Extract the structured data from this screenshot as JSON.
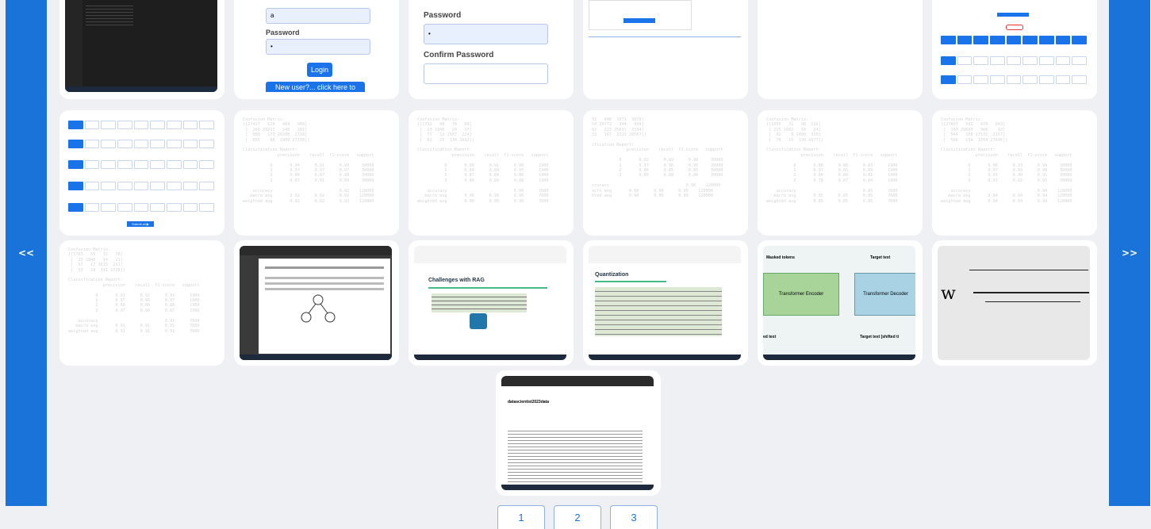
{
  "nav": {
    "prev_label": "<<",
    "next_label": ">>"
  },
  "pagination": [
    "1",
    "2",
    "3"
  ],
  "thumbs": {
    "login": {
      "password_label": "Password",
      "username_value": "a",
      "password_value": "•",
      "login_button": "Login",
      "register_link": "New user?... click here to Register"
    },
    "register": {
      "password_label": "Password",
      "confirm_label": "Confirm Password",
      "password_value": "•"
    },
    "terminal_1": "Confusion Matrix:\n[[27427   620   964   989]\n [  266 29213   240   281]\n [  909   173 26200  2718]\n [  655    98  1909 27338]]\n\nClassification Report:\n              precision    recall  f1-score   support\n\n           0       0.94      0.91      0.93     30000\n           1       0.97      0.97      0.97     30000\n           2       0.89      0.87      0.88     30000\n           3       0.87      0.91      0.89     30000\n\n    accuracy                           0.92    120000\n   macro avg       0.92      0.92      0.92    120000\nweighted avg       0.92      0.92      0.92    120000",
    "terminal_2": "Confusion Matrix:\n[[1712   48   70   60]\n [  23 1840   20   17]\n [  77   12 1587  224]\n [  63   15  130 1692]]\n\nClassification Report:\n              precision    recall  f1-score   support\n\n           0       0.90      0.91      0.90      1900\n           1       0.89      0.84      0.95      1900\n           2       0.87      0.84      0.86      1900\n           3       0.84      0.89      0.88      1900\n\n    accuracy                           0.90      7600\n   macro avg       0.90      0.90      0.90      7600\nweighted avg       0.90      0.90      0.90      7600",
    "terminal_3": "31   640  1671  3878]\n50 20772   344   434]\n02   223 25631  3334]\n33   167  2313 26507]]\n\nification Report:\n              precision    recall  f1-score   support\n\n           0       0.92      0.89      0.90     30000\n           1       0.97      0.96      0.96     30000\n           2       0.86      0.85      0.85     30000\n           3       0.85      0.88      0.86     30000\n\nccuracy                               0.90    120000\nacro avg       0.90      0.90      0.90    120000\nhted avg       0.90      0.90      0.90    120000",
    "terminal_4": "Confusion Matrix:\n[[1655   31   98  116]\n [ 225 1602   39   24]\n [  92    8 1490  310]\n [  78   15  130 1677]]\n\nClassification Report:\n              precision    recall  f1-score   support\n\n           0       0.80      0.88      0.83      1900\n           1       0.97      0.85      0.89      1900\n           2       0.84      0.80      0.81      1900\n           3       0.78      0.87      0.84      1900\n\n    accuracy                           0.85      7600\n   macro avg       0.85      0.85      0.85      7600\nweighted avg       0.85      0.85      0.85      7600",
    "terminal_5": "Confusion Matrix:\n[[27807   592   878   643]\n [  103 29699   306    92]\n [  544   160 27131  2157]\n [  566   134  1654 27646]]\n\nClassification Report:\n              precision    recall  f1-score   support\n\n           0       0.96      0.93      0.94     30000\n           1       0.97      0.99      0.98     30000\n           2       0.91      0.90      0.91     30000\n           3       0.91      0.92      0.91     30000\n\n    accuracy                           0.94    120000\n   macro avg       0.94      0.94      0.94    120000\nweighted avg       0.94      0.94      0.94    120000",
    "terminal_6": "Confusion Matrix:\n[[1703   55   72   70]\n [  25 1840   14   21]\n [  57   17 1615  211]\n [  53   18  111 1718]]\n\nClassification Report:\n              precision    recall  f1-score   support\n\n           0       0.91      0.92      0.91      1900\n           1       0.97      0.96      0.97      1900\n           2       0.88      0.86      0.88      1900\n           3       0.97      0.90      0.87      1900\n\n    accuracy                           0.91      7600\n   macro avg       0.91      0.91      0.91      7600\nweighted avg       0.91      0.91      0.91      7600",
    "rag_title": "Challenges with RAG",
    "quant_title": "Quantization",
    "transformer": {
      "masked_tokens": "Masked tokens",
      "target_text": "Target text",
      "encoder": "Transformer Encoder",
      "decoder": "Transformer Decoder",
      "input_text": "ed text",
      "target_shifted": "Target text [shifted ti"
    },
    "formula": "w",
    "notebook_title": "datascientist2023data",
    "submit_label": "Submit all ▶",
    "upload_label": "UPLOAD IMAGES"
  },
  "colors": {
    "accent": "#1a73d9",
    "background": "#eef0f3"
  }
}
